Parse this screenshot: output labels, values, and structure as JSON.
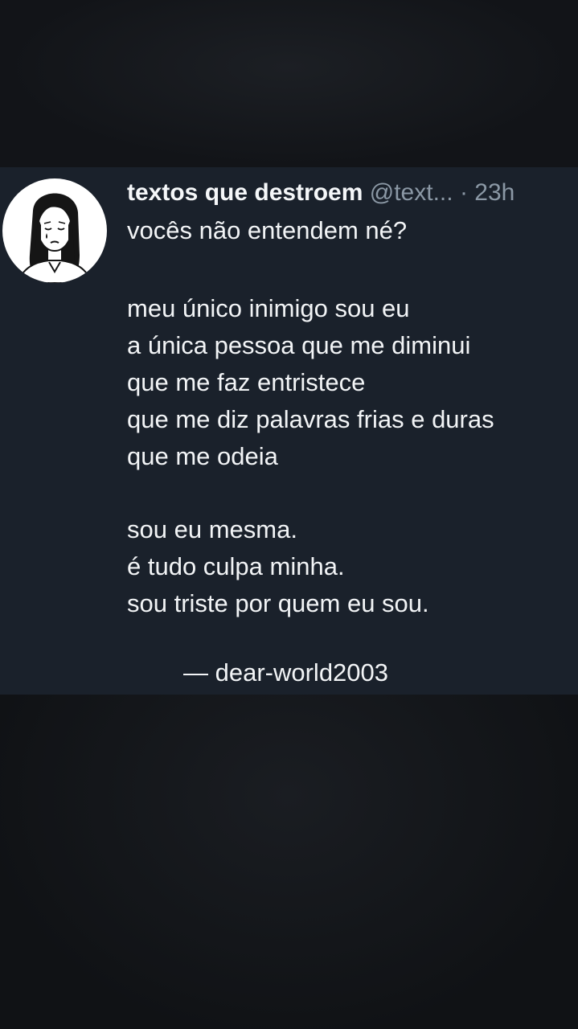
{
  "tweet": {
    "author_name": "textos que destroem",
    "author_handle": "@text...",
    "separator": "·",
    "timestamp": "23h",
    "avatar_icon": "sad-girl-illustration-icon",
    "lines_1": [
      "vocês não entendem né?"
    ],
    "lines_2": [
      "meu único inimigo sou eu",
      "a única pessoa que me diminui",
      "que me faz entristece",
      "que me diz palavras frias e duras",
      "que me odeia"
    ],
    "lines_3": [
      "sou eu mesma.",
      "é tudo culpa minha.",
      "sou triste por quem eu sou."
    ],
    "signature": "— dear-world2003"
  },
  "colors": {
    "tweet_background": "#1a212b",
    "text": "#f2f4f6",
    "muted": "#8b98a5",
    "page_background": "#131519"
  }
}
